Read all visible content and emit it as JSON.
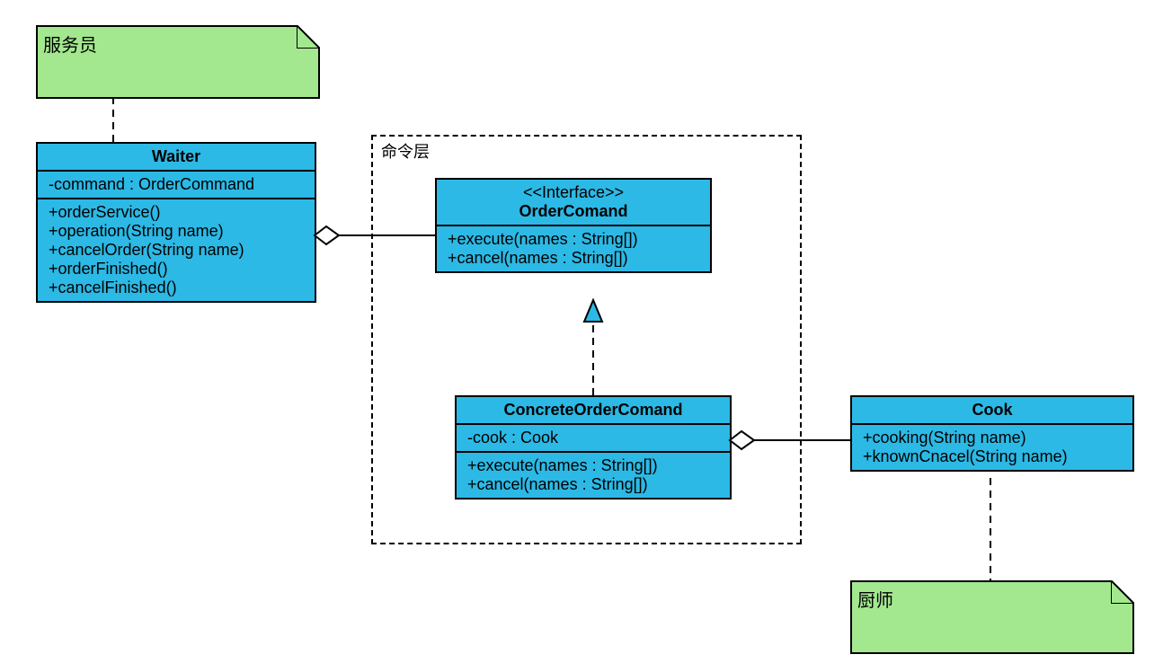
{
  "notes": {
    "waiter": {
      "label": "服务员"
    },
    "chef": {
      "label": "厨师"
    }
  },
  "package": {
    "label": "命令层"
  },
  "classes": {
    "waiter": {
      "name": "Waiter",
      "attrs": [
        "-command : OrderCommand"
      ],
      "ops": [
        "+orderService()",
        "+operation(String name)",
        "+cancelOrder(String name)",
        "+orderFinished()",
        "+cancelFinished()"
      ]
    },
    "orderCommand": {
      "stereotype": "<<Interface>>",
      "name": "OrderComand",
      "ops": [
        "+execute(names : String[])",
        "+cancel(names : String[])"
      ]
    },
    "concreteOrderCommand": {
      "name": "ConcreteOrderComand",
      "attrs": [
        "-cook : Cook"
      ],
      "ops": [
        "+execute(names : String[])",
        "+cancel(names : String[])"
      ]
    },
    "cook": {
      "name": "Cook",
      "ops": [
        "+cooking(String name)",
        "+knownCnacel(String name)"
      ]
    }
  }
}
